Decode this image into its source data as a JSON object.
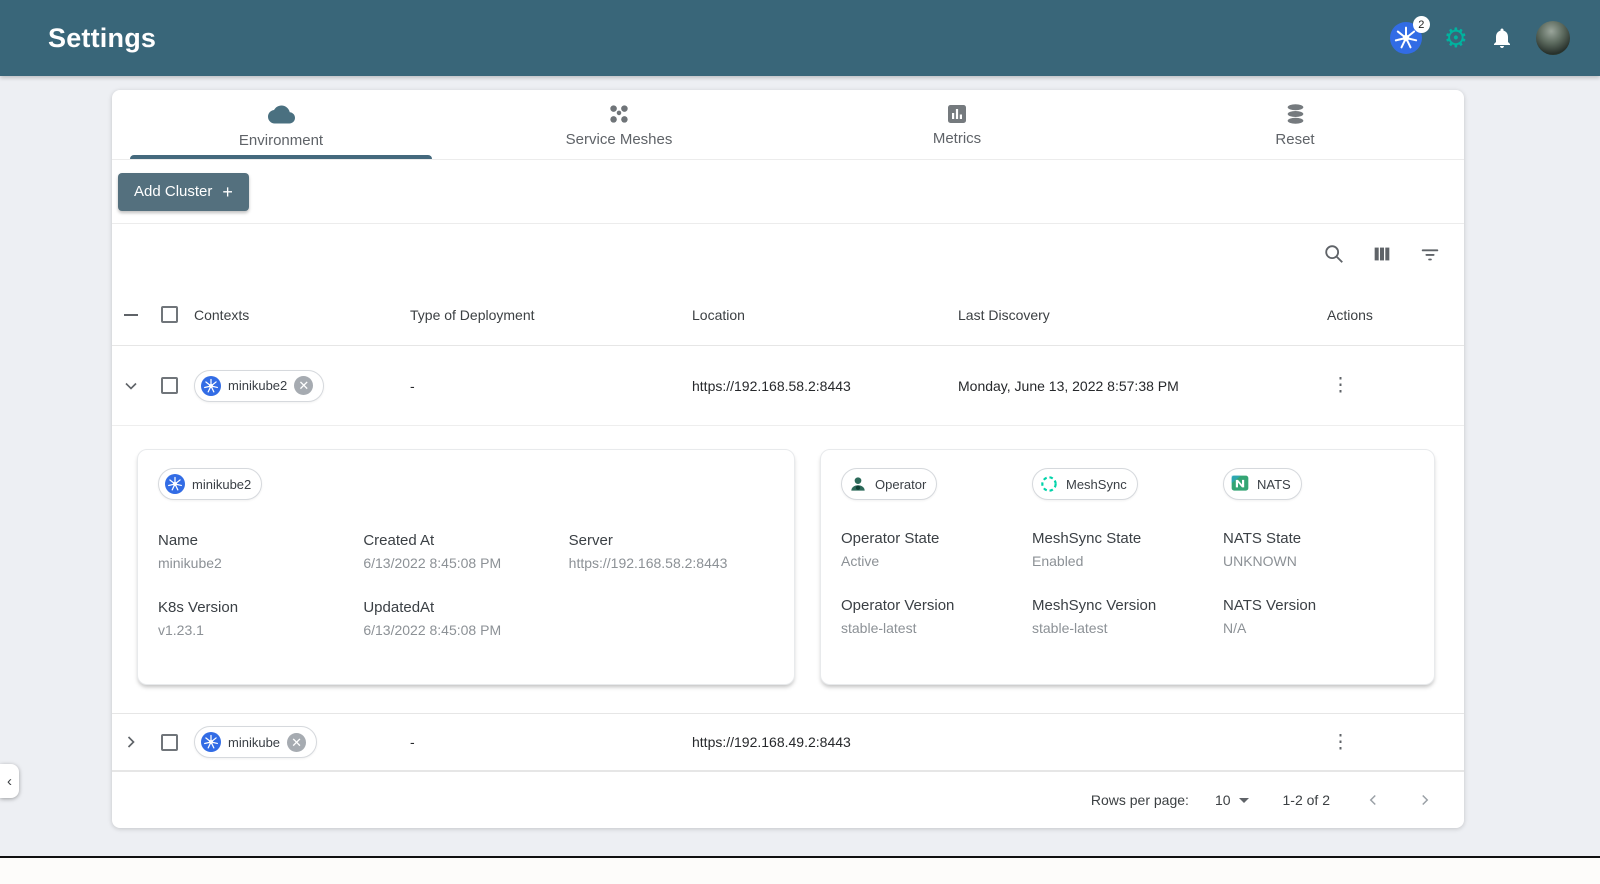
{
  "header": {
    "title": "Settings",
    "k8s_badge_count": "2"
  },
  "tabs": [
    {
      "label": "Environment",
      "active": true
    },
    {
      "label": "Service Meshes",
      "active": false
    },
    {
      "label": "Metrics",
      "active": false
    },
    {
      "label": "Reset",
      "active": false
    }
  ],
  "actions_bar": {
    "add_cluster_label": "Add Cluster",
    "plus": "+"
  },
  "table": {
    "columns": [
      "Contexts",
      "Type of Deployment",
      "Location",
      "Last Discovery",
      "Actions"
    ],
    "rows": [
      {
        "context": "minikube2",
        "type_of_deployment": "-",
        "location": "https://192.168.58.2:8443",
        "last_discovery": "Monday, June 13, 2022 8:57:38 PM"
      },
      {
        "context": "minikube",
        "type_of_deployment": "-",
        "location": "https://192.168.49.2:8443",
        "last_discovery": ""
      }
    ]
  },
  "detail_panel": {
    "cluster": {
      "chip": "minikube2",
      "fields": [
        {
          "label": "Name",
          "value": "minikube2"
        },
        {
          "label": "Created At",
          "value": "6/13/2022 8:45:08 PM"
        },
        {
          "label": "Server",
          "value": "https://192.168.58.2:8443"
        },
        {
          "label": "K8s Version",
          "value": "v1.23.1"
        },
        {
          "label": "UpdatedAt",
          "value": "6/13/2022 8:45:08 PM"
        }
      ]
    },
    "operator": {
      "chips": [
        "Operator",
        "MeshSync",
        "NATS"
      ],
      "fields": [
        {
          "label": "Operator State",
          "value": "Active"
        },
        {
          "label": "MeshSync State",
          "value": "Enabled"
        },
        {
          "label": "NATS State",
          "value": "UNKNOWN"
        },
        {
          "label": "Operator Version",
          "value": "stable-latest"
        },
        {
          "label": "MeshSync Version",
          "value": "stable-latest"
        },
        {
          "label": "NATS Version",
          "value": "N/A"
        }
      ]
    }
  },
  "pagination": {
    "rows_per_page_label": "Rows per page:",
    "rows_per_page_value": "10",
    "range_label": "1-2 of 2"
  },
  "colors": {
    "header_teal": "#396679",
    "accent_green": "#00B39F",
    "k8s_blue": "#326CE5",
    "button_slate": "#54707E"
  }
}
